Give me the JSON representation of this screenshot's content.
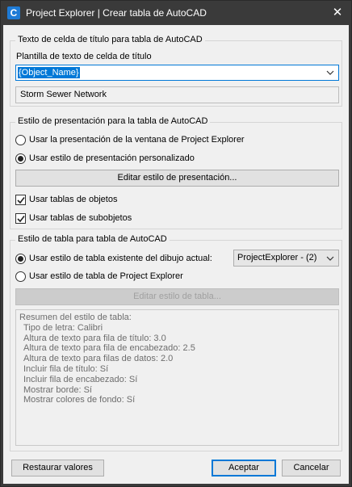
{
  "window": {
    "title": "Project Explorer | Crear tabla de AutoCAD",
    "icon_letter": "C"
  },
  "title_group": {
    "legend": "Texto de celda de título para tabla de AutoCAD",
    "template_label": "Plantilla de texto de celda de título",
    "template_value": "{Object_Name}",
    "preview_value": "Storm Sewer Network"
  },
  "presentation_group": {
    "legend": "Estilo de presentación para la tabla de AutoCAD",
    "radio_window": "Usar la presentación de la ventana de Project Explorer",
    "radio_custom": "Usar estilo de presentación personalizado",
    "edit_button": "Editar estilo de presentación...",
    "check_objects": "Usar tablas de objetos",
    "check_subobjects": "Usar tablas de subobjetos"
  },
  "table_style_group": {
    "legend": "Estilo de tabla para tabla de AutoCAD",
    "radio_existing": "Usar estilo de tabla existente del dibujo actual:",
    "existing_style_value": "ProjectExplorer - (2)",
    "radio_project": "Usar estilo de tabla de Project Explorer",
    "edit_button": "Editar estilo de tabla...",
    "summary": {
      "heading": "Resumen del estilo de tabla:",
      "lines": [
        "Tipo de letra: Calibri",
        "Altura de texto para fila de título: 3.0",
        "Altura de texto para fila de encabezado: 2.5",
        "Altura de texto para filas de datos: 2.0",
        "Incluir fila de título: Sí",
        "Incluir fila de encabezado: Sí",
        "Mostrar borde: Sí",
        "Mostrar colores de fondo: Sí"
      ]
    }
  },
  "footer": {
    "restore_button": "Restaurar valores",
    "accept_button": "Aceptar",
    "cancel_button": "Cancelar"
  },
  "colors": {
    "accent": "#0078d7",
    "titlebar": "#3a3a3a",
    "dialog_bg": "#f0f0f0"
  }
}
